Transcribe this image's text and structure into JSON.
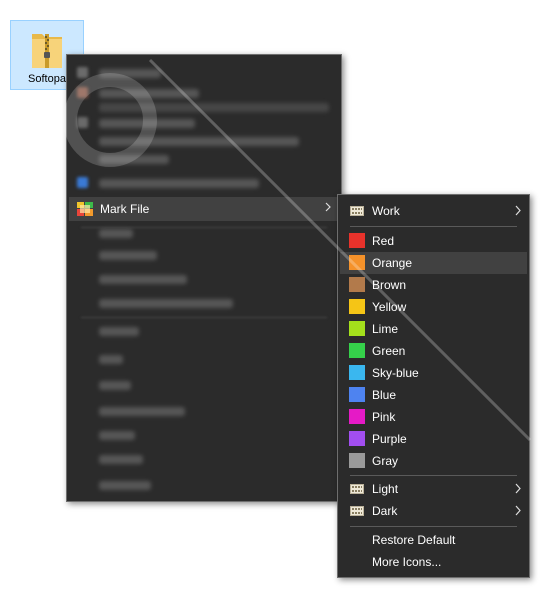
{
  "desktop": {
    "icon_label": "Softopa",
    "icon_name": "zip-folder-icon"
  },
  "context_menu": {
    "mark_file_label": "Mark File",
    "mark_file_icon": "mark-file-icon"
  },
  "submenu": {
    "work_label": "Work",
    "colors": [
      {
        "label": "Red",
        "color": "#e8322b"
      },
      {
        "label": "Orange",
        "color": "#f5922a"
      },
      {
        "label": "Brown",
        "color": "#b27a4b"
      },
      {
        "label": "Yellow",
        "color": "#f5c516"
      },
      {
        "label": "Lime",
        "color": "#a4e01c"
      },
      {
        "label": "Green",
        "color": "#35d14a"
      },
      {
        "label": "Sky-blue",
        "color": "#3ab7ef"
      },
      {
        "label": "Blue",
        "color": "#4e83f0"
      },
      {
        "label": "Pink",
        "color": "#e51ac6"
      },
      {
        "label": "Purple",
        "color": "#a24ef0"
      },
      {
        "label": "Gray",
        "color": "#9a9a9a"
      }
    ],
    "highlighted": "Orange",
    "light_label": "Light",
    "dark_label": "Dark",
    "restore_label": "Restore Default",
    "more_label": "More Icons..."
  }
}
